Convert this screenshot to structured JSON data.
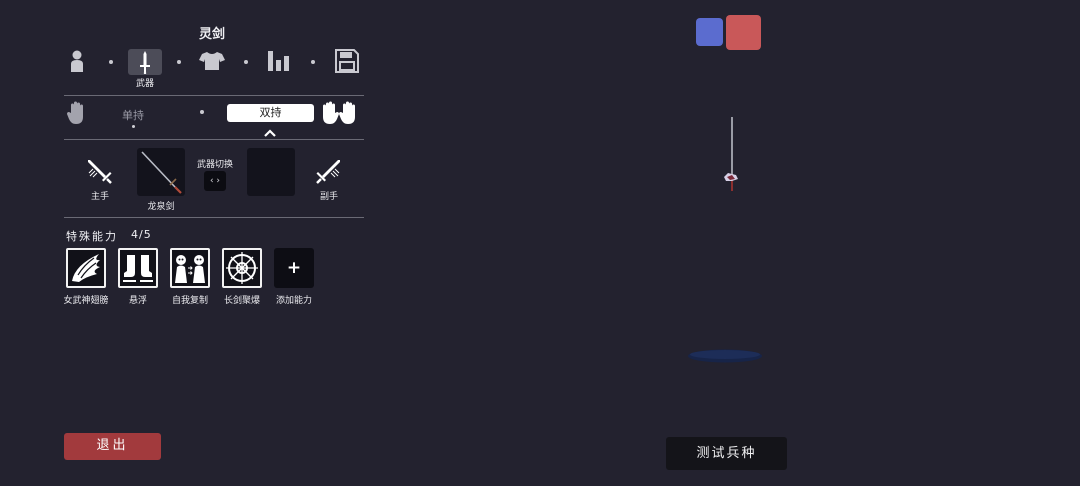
{
  "panel": {
    "title": "灵剑",
    "nav": {
      "active_label": "武器",
      "items": [
        {
          "icon": "person-icon"
        },
        {
          "icon": "sword-icon",
          "label": "武器"
        },
        {
          "icon": "shirt-icon"
        },
        {
          "icon": "stats-icon"
        },
        {
          "icon": "save-icon"
        }
      ]
    },
    "hold_mode": {
      "single": "单持",
      "dual": "双持",
      "selected": "双持"
    },
    "weapons": {
      "main_hand_label": "主手",
      "main_weapon_name": "龙泉剑",
      "switch_label": "武器切换",
      "switch_glyph": "‹ ›",
      "off_hand_label": "副手"
    },
    "abilities": {
      "title": "特殊能力",
      "count": "4/5",
      "items": [
        {
          "name": "女武神翅膀",
          "icon": "wings-icon"
        },
        {
          "name": "悬浮",
          "icon": "boots-icon"
        },
        {
          "name": "自我复制",
          "icon": "clone-icon"
        },
        {
          "name": "长剑聚爆",
          "icon": "crosshair-icon"
        }
      ],
      "add_label": "添加能力",
      "add_glyph": "+"
    },
    "exit_label": "退出"
  },
  "viewport": {
    "team_colors": [
      "#5b6ccf",
      "#c95859"
    ],
    "test_button_label": "测试兵种"
  }
}
